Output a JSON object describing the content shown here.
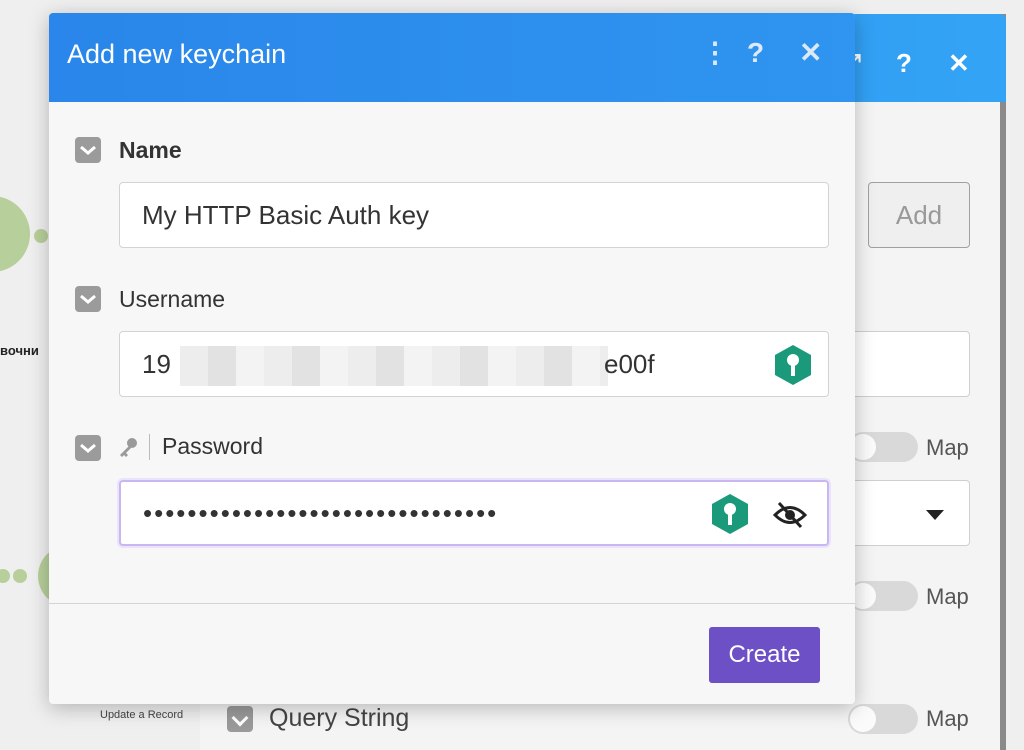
{
  "dialog": {
    "title": "Add new keychain",
    "header_buttons": {
      "more": "⋮",
      "help": "?",
      "close": "✕"
    },
    "fields": {
      "name": {
        "label": "Name",
        "value": "My HTTP Basic Auth key"
      },
      "username": {
        "label": "Username",
        "value_start": "19",
        "value_end": "e00f"
      },
      "password": {
        "label": "Password",
        "value": "••••••••••••••••••••••••••••••••"
      }
    },
    "create_label": "Create"
  },
  "background": {
    "header_buttons": {
      "expand": "⤢",
      "help": "?",
      "close": "✕"
    },
    "add_label": "Add",
    "map_label": "Map",
    "query_string_label": "Query String",
    "canvas_label": "вочни",
    "canvas_sublabel": "Update a Record"
  },
  "colors": {
    "header_blue": "#2a86ea",
    "create_purple": "#6d4fc6",
    "keychain_green": "#1a9a7a"
  },
  "icons": [
    "more-icon",
    "help-icon",
    "close-icon",
    "checkbox-icon",
    "key-icon",
    "keychain-hex-icon",
    "eye-slash-icon",
    "caret-down-icon"
  ]
}
